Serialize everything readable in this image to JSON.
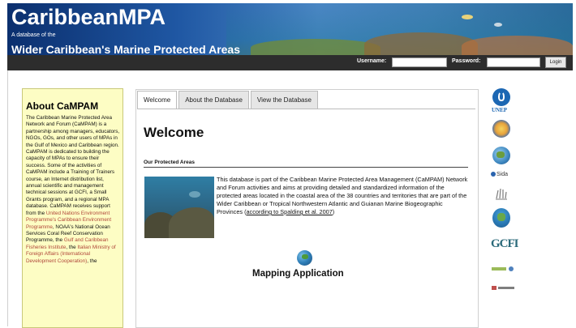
{
  "header": {
    "logo_text": "CaribbeanMPA",
    "tagline_small": "A database of the",
    "tagline_large": "Wider Caribbean's Marine Protected Areas",
    "username_label": "Username:",
    "username_value": "",
    "password_label": "Password:",
    "password_value": "",
    "login_button": "Login"
  },
  "sidebar": {
    "title": "About CaMPAM",
    "text_1": "The Caribbean Marine Protected Area Network and Forum (CaMPAM) is a partnership among managers, educators, NGOs, GOs, and other users of MPAs in the Gulf of Mexico and Caribbean region. CaMPAM is dedicated to building the capacity of MPAs to ensure their success. Some of the activities of CaMPAM include a Training of Trainers course, an Internet distribution list, annual scientific and management technical sessions at GCFI, a Small Grants program, and a regional MPA database. CaMPAM receives support from the ",
    "link_1": "United Nations Environment Programme's Caribbean Environment Programme",
    "text_2": ", NOAA's National Ocean Services Coral Reef Conservation Programme",
    "text_3": ", the ",
    "link_2": "Gulf and Caribbean Fisheries Institute",
    "text_4": ", the ",
    "link_3": "Italian Ministry of Foreign Affairs (International Development Cooperation)",
    "text_5": ", the"
  },
  "tabs": [
    {
      "label": "Welcome",
      "active": true
    },
    {
      "label": "About the Database",
      "active": false
    },
    {
      "label": "View the Database",
      "active": false
    }
  ],
  "main": {
    "heading": "Welcome",
    "section_title": "Our Protected Areas",
    "description": "This database is part of the Caribbean Marine Protected Area Management (CaMPAM) Network and Forum activities and aims at providing detailed and standardized information of the protected areas located in the coastal area of the 38 countries and territories that are part of the Wider Caribbean or Tropical Northwestern Atlantic and Guianan Marine Biogeographic Provinces (",
    "description_link": "according to Spalding et al. 2007",
    "description_end": ")",
    "mapping_label": "Mapping Application"
  },
  "partners": {
    "unep": "UNEP",
    "sida": "Sida",
    "gcfi": "GCFI"
  }
}
